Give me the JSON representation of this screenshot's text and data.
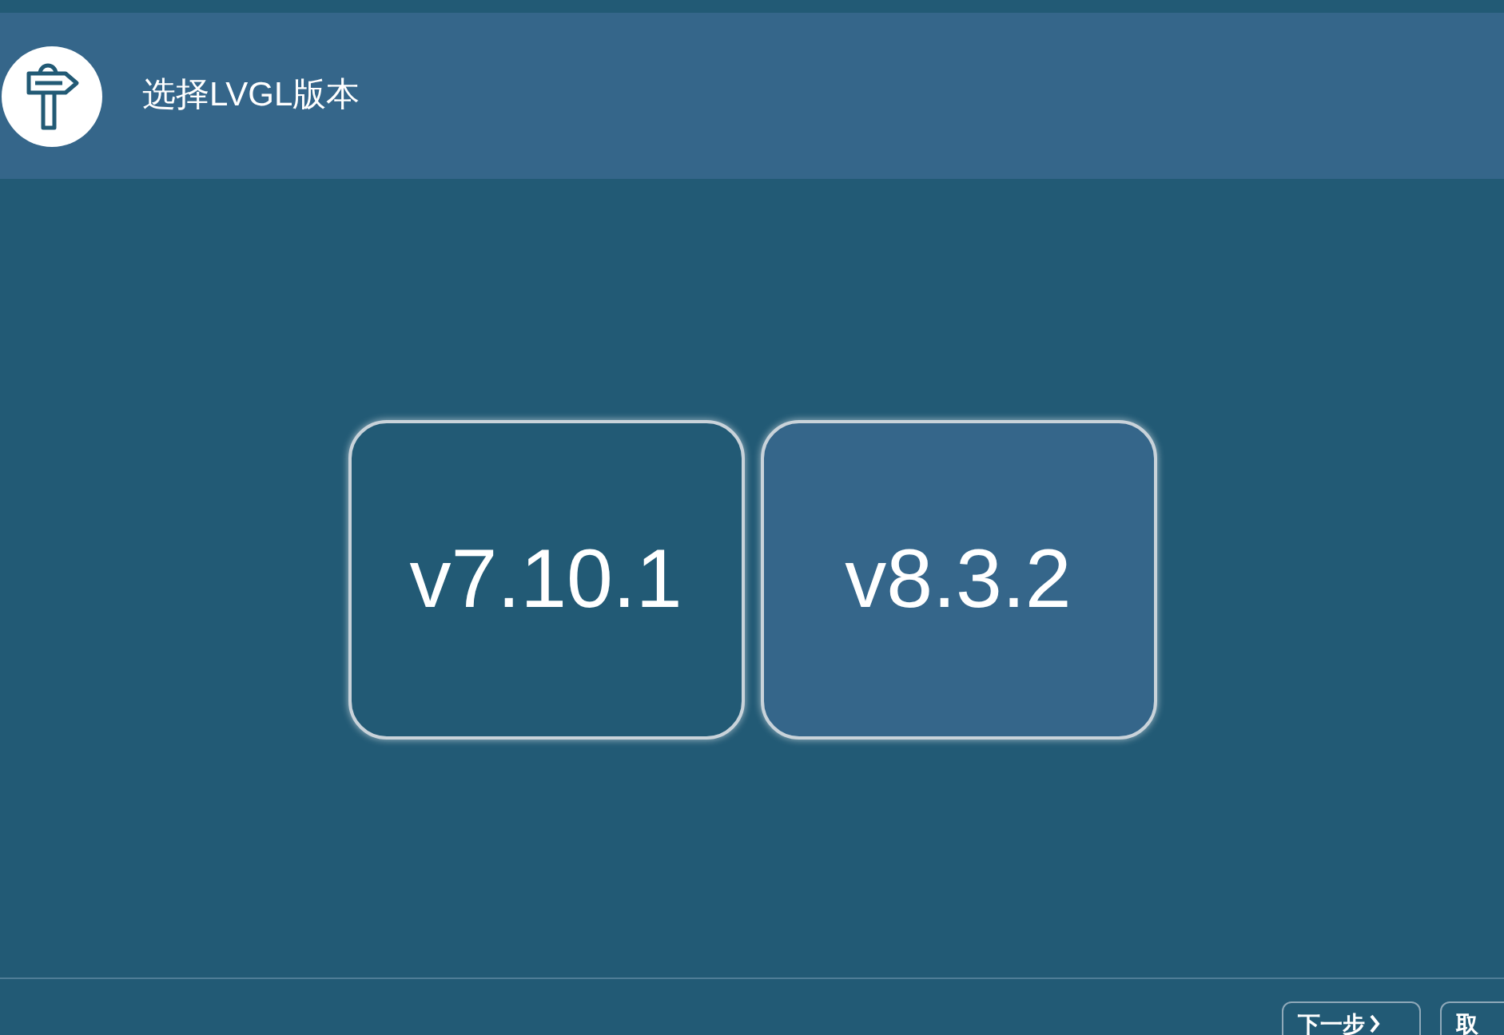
{
  "header": {
    "title": "选择LVGL版本"
  },
  "versions": [
    {
      "label": "v7.10.1",
      "selected": false
    },
    {
      "label": "v8.3.2",
      "selected": true
    }
  ],
  "footer": {
    "buttons": [
      {
        "label": "下一步",
        "kind": "next"
      },
      {
        "label": "取",
        "kind": "plain"
      }
    ]
  }
}
